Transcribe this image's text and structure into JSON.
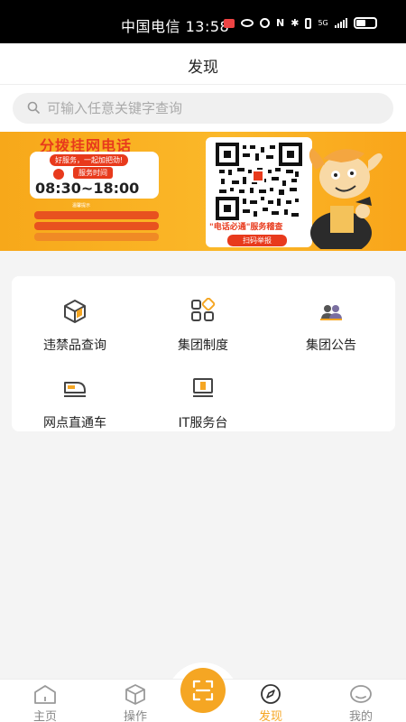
{
  "status_bar": {
    "carrier": "中国电信",
    "time": "13:58",
    "network": "5G"
  },
  "header": {
    "title": "发现"
  },
  "search": {
    "placeholder": "可输入任意关键字查询"
  },
  "banner": {
    "title": "分拨挂网电话",
    "slogan": "好服务，一起加把劲!",
    "hours_label": "服务时间",
    "hours": "08:30~18:00",
    "note_title": "温馨提示",
    "qr_caption": "\"电话必通\"服务稽查",
    "report_button": "扫码举报"
  },
  "grid": {
    "items": [
      {
        "label": "违禁品查询",
        "icon": "box-icon"
      },
      {
        "label": "集团制度",
        "icon": "apps-icon"
      },
      {
        "label": "集团公告",
        "icon": "users-icon"
      },
      {
        "label": "网点直通车",
        "icon": "train-icon"
      },
      {
        "label": "IT服务台",
        "icon": "monitor-icon"
      }
    ]
  },
  "tabbar": {
    "tabs": [
      {
        "label": "主页",
        "icon": "home-icon"
      },
      {
        "label": "操作",
        "icon": "cube-icon"
      },
      {
        "label": "发现",
        "icon": "compass-icon",
        "active": true
      },
      {
        "label": "我的",
        "icon": "profile-icon"
      }
    ],
    "scan_icon": "scan-icon"
  },
  "colors": {
    "accent": "#f5a623",
    "banner_red": "#e83a1c",
    "active_tab": "#f5a623"
  }
}
